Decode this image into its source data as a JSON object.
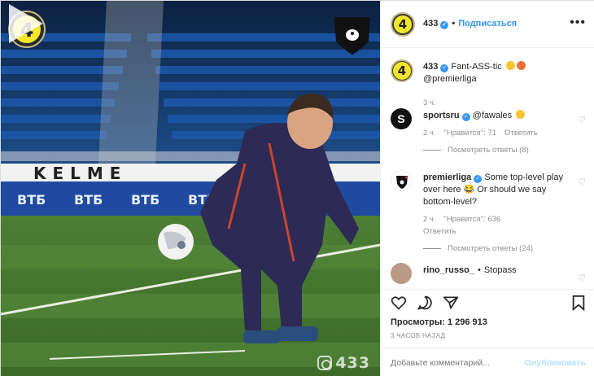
{
  "post": {
    "username": "433",
    "follow_label": "Подписаться",
    "caption_user": "433",
    "caption_text": "Fant-ASS-tic",
    "caption_mention": "@premierliga",
    "caption_time": "3 ч.",
    "more_label": "•••"
  },
  "media": {
    "logo_badge": "4",
    "watermark": "433"
  },
  "comments": [
    {
      "user": "sportsru",
      "text": "@fawales",
      "time": "2 ч.",
      "likes": "\"Нравится\": 71",
      "reply": "Ответить",
      "view_replies": "Посмотреть ответы (8)"
    },
    {
      "user": "premierliga",
      "text": "Some top-level play over here 😂 Or should we say bottom-level?",
      "time": "2 ч.",
      "likes": "\"Нравится\": 636",
      "reply": "Ответить",
      "view_replies": "Посмотреть ответы (24)"
    },
    {
      "user": "rino_russo_",
      "text": "Stopass"
    }
  ],
  "stats": {
    "views": "Просмотры: 1 296 913",
    "posted": "3 ЧАСОВ НАЗАД"
  },
  "composer": {
    "placeholder": "Добавьте комментарий...",
    "publish": "Опубликовать"
  },
  "colors": {
    "accent": "#3897f0",
    "badge_yellow": "#f5e62a"
  }
}
